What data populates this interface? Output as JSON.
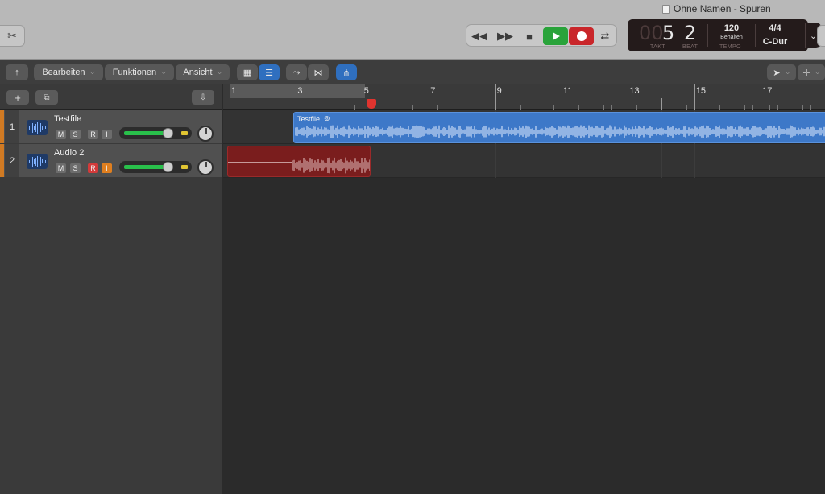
{
  "window": {
    "title": "Ohne Namen - Spuren"
  },
  "lcd": {
    "takt_zero": "00",
    "takt": "5",
    "beat": "2",
    "takt_label": "TAKT",
    "beat_label": "BEAT",
    "tempo": "120",
    "tempo_mode": "Behalten",
    "tempo_label": "TEMPO",
    "signature": "4/4",
    "key": "C-Dur"
  },
  "toolbar": {
    "edit": "Bearbeiten",
    "functions": "Funktionen",
    "view": "Ansicht"
  },
  "ruler": {
    "numbers": [
      "1",
      "3",
      "5",
      "7",
      "9",
      "11",
      "13",
      "15",
      "17"
    ]
  },
  "tracks": [
    {
      "number": "1",
      "name": "Testfile",
      "mute": "M",
      "solo": "S",
      "record": "R",
      "input": "I",
      "volume": 0.75
    },
    {
      "number": "2",
      "name": "Audio 2",
      "mute": "M",
      "solo": "S",
      "record": "R",
      "input": "I",
      "volume": 0.75
    }
  ],
  "regions": [
    {
      "name": "Testfile",
      "color": "#3d78c8"
    },
    {
      "name": "",
      "color": "#7a1d1d"
    }
  ],
  "colors": {
    "accent": "#2f6fbf",
    "play": "#29a33a",
    "record": "#c9262a",
    "playhead": "#d23a3a",
    "track_color": "#d07a23"
  }
}
